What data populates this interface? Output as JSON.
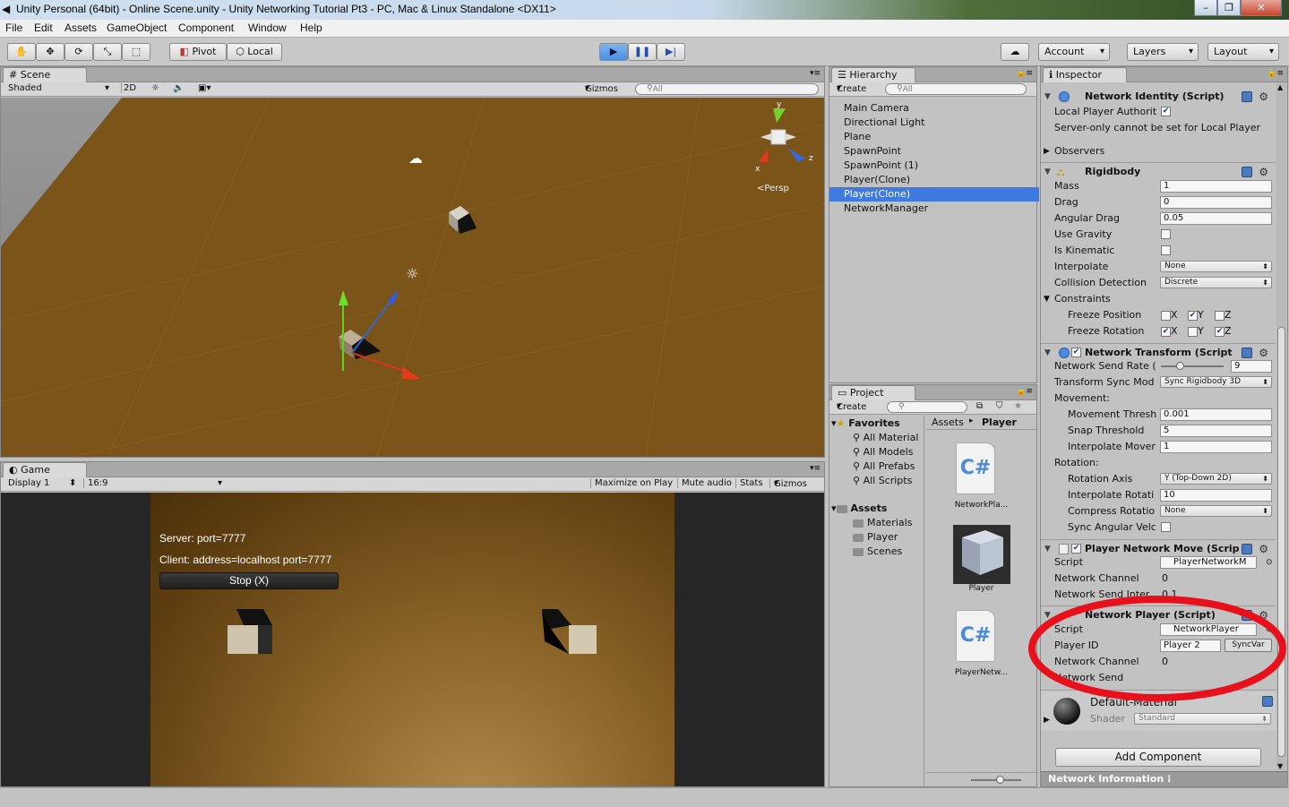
{
  "window": {
    "title": "Unity Personal (64bit) - Online Scene.unity - Unity Networking Tutorial Pt3 - PC, Mac & Linux Standalone <DX11>",
    "min": "–",
    "max": "❐",
    "close": "✕"
  },
  "menu": [
    "File",
    "Edit",
    "Assets",
    "GameObject",
    "Component",
    "Window",
    "Help"
  ],
  "toolbar": {
    "pivot": "Pivot",
    "local": "Local",
    "account": "Account",
    "layers": "Layers",
    "layout": "Layout",
    "cloud_icon": "cloud-icon"
  },
  "scene": {
    "tab": "Scene",
    "shading": "Shaded",
    "mode2d": "2D",
    "gizmos": "Gizmos",
    "search": "All",
    "persp": "Persp",
    "axis_y": "y",
    "axis_x": "x",
    "axis_z": "z"
  },
  "game": {
    "tab": "Game",
    "display": "Display 1",
    "aspect": "16:9",
    "maximize": "Maximize on Play",
    "mute": "Mute audio",
    "stats": "Stats",
    "gizmos": "Gizmos",
    "server": "Server: port=7777",
    "client": "Client: address=localhost port=7777",
    "stop": "Stop (X)"
  },
  "hierarchy": {
    "tab": "Hierarchy",
    "create": "Create",
    "search": "All",
    "items": [
      "Main Camera",
      "Directional Light",
      "Plane",
      "SpawnPoint",
      "SpawnPoint (1)",
      "Player(Clone)",
      "Player(Clone)",
      "NetworkManager"
    ],
    "selected_index": 6
  },
  "project": {
    "tab": "Project",
    "create": "Create",
    "favorites": "Favorites",
    "fav_items": [
      "All Material",
      "All Models",
      "All Prefabs",
      "All Scripts"
    ],
    "assets": "Assets",
    "asset_folders": [
      "Materials",
      "Player",
      "Scenes"
    ],
    "breadcrumb_root": "Assets",
    "breadcrumb_sep": "▸",
    "breadcrumb_current": "Player",
    "files": [
      {
        "name": "NetworkPla...",
        "type": "cs"
      },
      {
        "name": "Player",
        "type": "prefab"
      },
      {
        "name": "PlayerNetw...",
        "type": "cs"
      }
    ]
  },
  "inspector": {
    "tab": "Inspector",
    "network_identity": {
      "title": "Network Identity (Script)",
      "local_player_label": "Local Player Authorit",
      "local_player_checked": "✔",
      "warning": "Server-only cannot be set for Local Player",
      "observers": "Observers"
    },
    "rigidbody": {
      "title": "Rigidbody",
      "mass_label": "Mass",
      "mass": "1",
      "drag_label": "Drag",
      "drag": "0",
      "angular_drag_label": "Angular Drag",
      "angular_drag": "0.05",
      "use_gravity_label": "Use Gravity",
      "is_kinematic_label": "Is Kinematic",
      "interpolate_label": "Interpolate",
      "interpolate": "None",
      "collision_label": "Collision Detection",
      "collision": "Discrete",
      "constraints": "Constraints",
      "freeze_pos_label": "Freeze Position",
      "freeze_rot_label": "Freeze Rotation",
      "x": "X",
      "y": "Y",
      "z": "Z",
      "check": "✔"
    },
    "network_transform": {
      "title": "Network Transform (Script",
      "send_rate_label": "Network Send Rate (",
      "send_rate": "9",
      "send_rate_fraction": 0.3,
      "sync_mode_label": "Transform Sync Mod",
      "sync_mode": "Sync Rigidbody 3D",
      "movement": "Movement:",
      "move_thresh_label": "Movement Thresh",
      "move_thresh": "0.001",
      "snap_label": "Snap Threshold",
      "snap": "5",
      "interp_move_label": "Interpolate Mover",
      "interp_move": "1",
      "rotation": "Rotation:",
      "rot_axis_label": "Rotation Axis",
      "rot_axis": "Y (Top-Down 2D)",
      "interp_rot_label": "Interpolate Rotati",
      "interp_rot": "10",
      "compress_label": "Compress Rotatio",
      "compress": "None",
      "sync_ang_label": "Sync Angular Velc"
    },
    "player_network_move": {
      "title": "Player Network Move (Scrip",
      "script_label": "Script",
      "script": "PlayerNetworkM",
      "channel_label": "Network Channel",
      "channel": "0",
      "send_label": "Network Send Inter",
      "send": "0.1"
    },
    "network_player": {
      "title": "Network Player (Script)",
      "script_label": "Script",
      "script": "NetworkPlayer",
      "player_id_label": "Player ID",
      "player_id": "Player 2",
      "syncvar": "SyncVar",
      "channel_label": "Network Channel",
      "channel": "0",
      "send_label": "Network Send"
    },
    "material": {
      "name": "Default-Material",
      "shader_label": "Shader",
      "shader": "Standard"
    },
    "add_component": "Add Component",
    "network_info": "Network Information"
  },
  "colors": {
    "accent": "#3e7ae0",
    "highlight_ring": "#e8101a",
    "play_active": "#5a9de8",
    "floor": "#7a5418"
  }
}
